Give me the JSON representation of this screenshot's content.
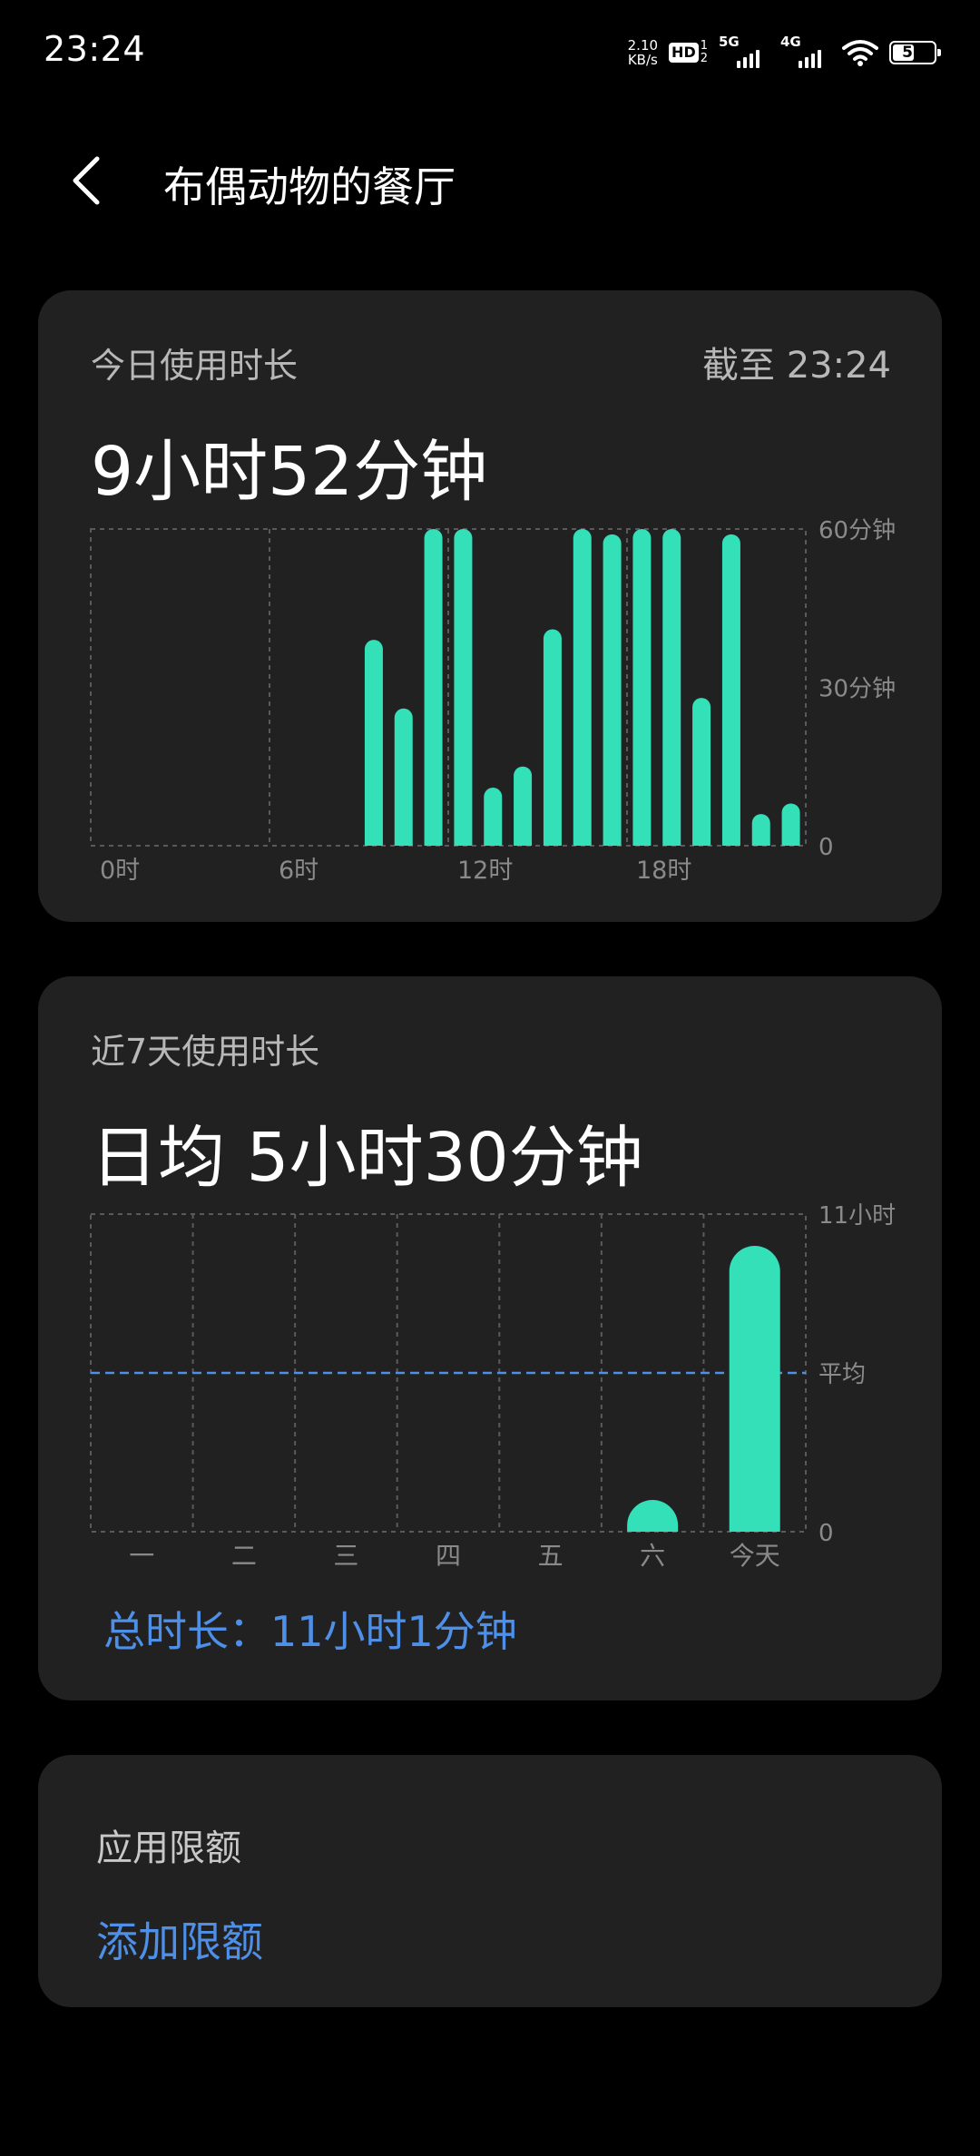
{
  "status": {
    "time": "23:24",
    "net_speed_value": "2.10",
    "net_speed_unit": "KB/s",
    "hd_tag": "HD",
    "hd_sub_top": "1",
    "hd_sub_bottom": "2",
    "sim1_label": "5G",
    "sim2_label": "4G",
    "battery": "52",
    "battery_level": 52
  },
  "header": {
    "title": "布偶动物的餐厅"
  },
  "today": {
    "label": "今日使用时长",
    "as_of": "截至 23:24",
    "total": "9小时52分钟"
  },
  "week": {
    "label": "近7天使用时长",
    "average": "日均 5小时30分钟",
    "total": "总时长：11小时1分钟"
  },
  "limit": {
    "label": "应用限额",
    "add": "添加限额"
  },
  "colors": {
    "bar": "#34e0b8",
    "average_line": "#4e8fe8",
    "link": "#4e8fe8"
  },
  "chart_data": [
    {
      "type": "bar",
      "categories": [
        "0",
        "1",
        "2",
        "3",
        "4",
        "5",
        "6",
        "7",
        "8",
        "9",
        "10",
        "11",
        "12",
        "13",
        "14",
        "15",
        "16",
        "17",
        "18",
        "19",
        "20",
        "21",
        "22",
        "23"
      ],
      "values": [
        0,
        0,
        0,
        0,
        0,
        0,
        0,
        0,
        0,
        39,
        26,
        60,
        60,
        11,
        15,
        41,
        60,
        59,
        60,
        60,
        28,
        59,
        6,
        8
      ],
      "ylim": [
        0,
        60
      ],
      "y_ticks": [
        {
          "value": 60,
          "label": "60分钟"
        },
        {
          "value": 30,
          "label": "30分钟"
        },
        {
          "value": 0,
          "label": "0"
        }
      ],
      "x_ticks": [
        {
          "value": 0,
          "label": "0时"
        },
        {
          "value": 6,
          "label": "6时"
        },
        {
          "value": 12,
          "label": "12时"
        },
        {
          "value": 18,
          "label": "18时"
        }
      ],
      "grid": true
    },
    {
      "type": "bar",
      "categories": [
        "一",
        "二",
        "三",
        "四",
        "五",
        "六",
        "今天"
      ],
      "values": [
        0,
        0,
        0,
        0,
        0,
        1.1,
        9.9
      ],
      "ylim": [
        0,
        11
      ],
      "average": 5.5,
      "y_ticks": [
        {
          "value": 11,
          "label": "11小时"
        },
        {
          "value": 5.5,
          "label": "平均"
        },
        {
          "value": 0,
          "label": "0"
        }
      ],
      "grid": true
    }
  ]
}
